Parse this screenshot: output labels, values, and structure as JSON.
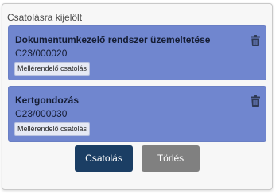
{
  "panel": {
    "title": "Csatolásra kijelölt"
  },
  "items": [
    {
      "title": "Dokumentumkezelő rendszer üzemeltetése",
      "code": "C23/000020",
      "badge": "Mellérendelő csatolás",
      "delete_icon": "trash-icon"
    },
    {
      "title": "Kertgondozás",
      "code": "C23/000030",
      "badge": "Mellérendelő csatolás",
      "delete_icon": "trash-icon"
    }
  ],
  "actions": {
    "attach_label": "Csatolás",
    "delete_label": "Törlés"
  },
  "colors": {
    "card_background": "#7086cf",
    "attach_button": "#1b3e64",
    "delete_button": "#808080"
  }
}
